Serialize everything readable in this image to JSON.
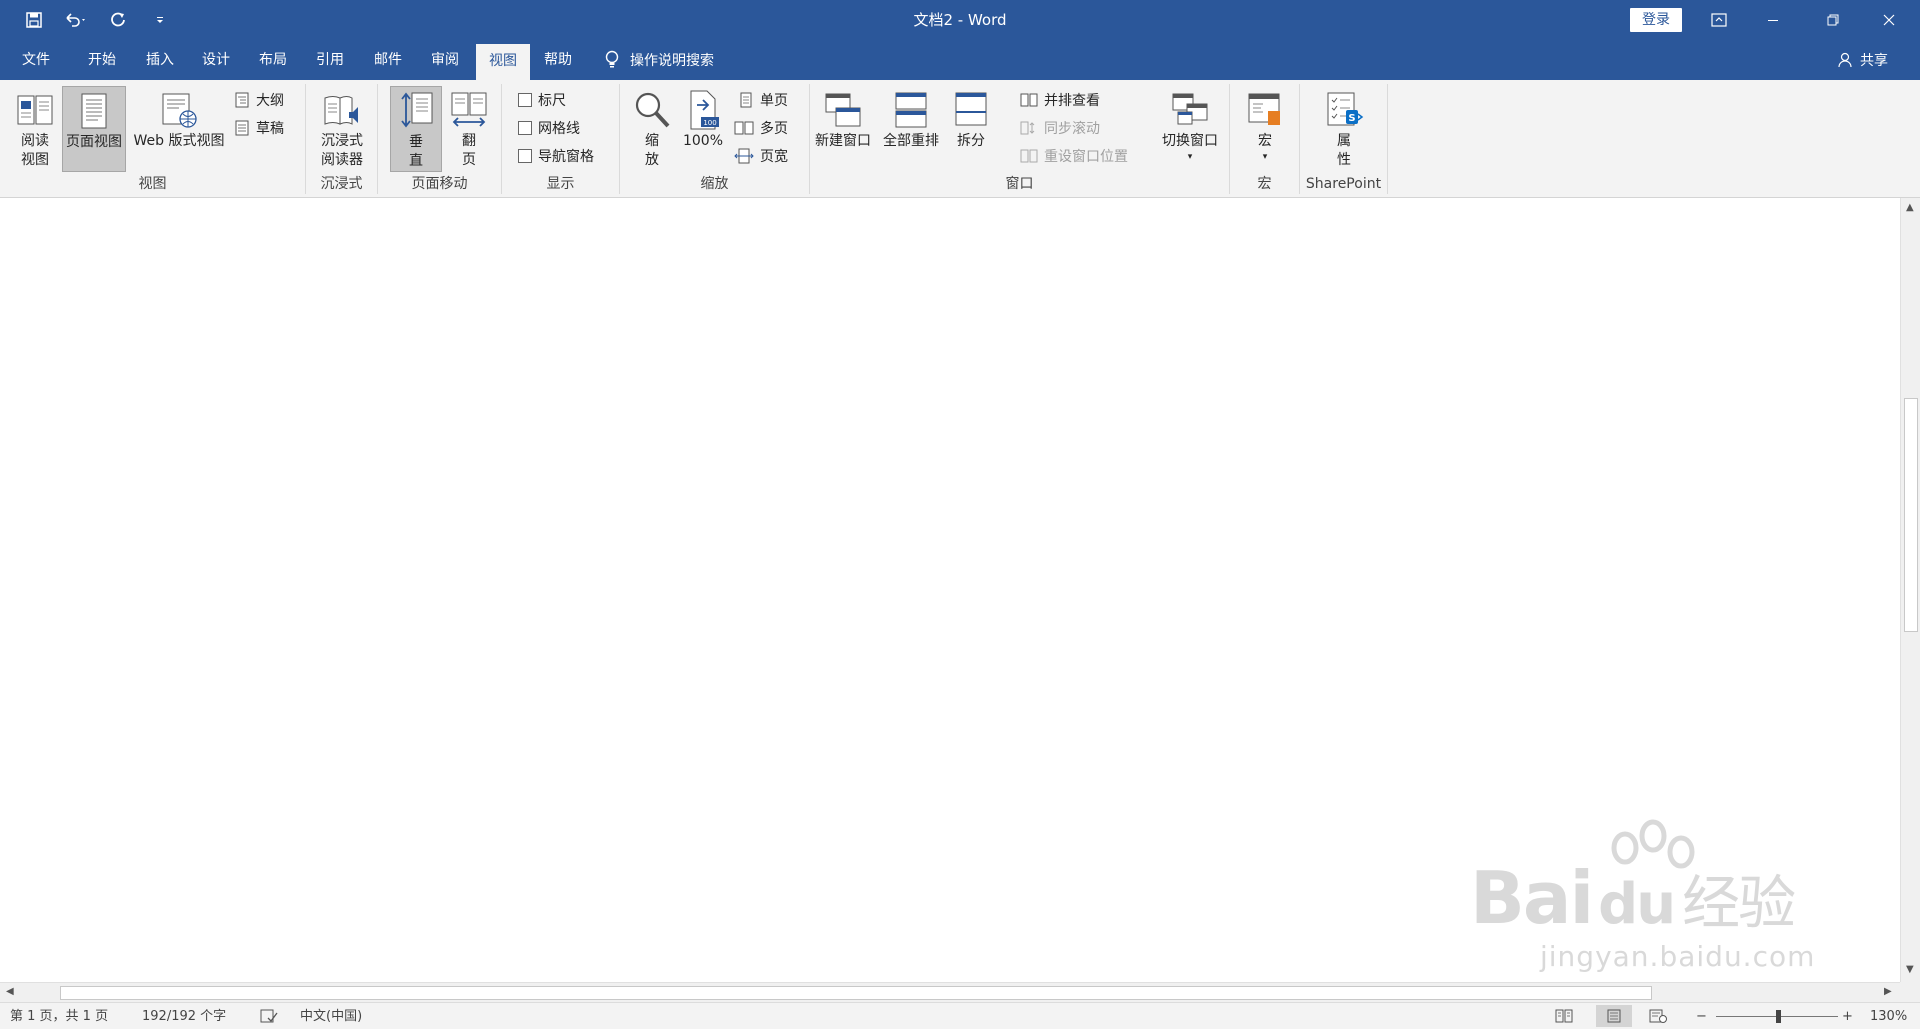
{
  "titlebar": {
    "title": "文档2  -  Word",
    "login": "登录",
    "bg": "#2b579a"
  },
  "tabs": [
    "文件",
    "开始",
    "插入",
    "设计",
    "布局",
    "引用",
    "邮件",
    "审阅",
    "视图",
    "帮助"
  ],
  "active_tab": "视图",
  "tellme": "操作说明搜索",
  "share": "共享",
  "ribbon": {
    "views": {
      "label": "视图",
      "read": "阅读\n视图",
      "print": "页面视图",
      "web": "Web 版式视图",
      "outline": "大纲",
      "draft": "草稿"
    },
    "immersive": {
      "label": "沉浸式",
      "reader": "沉浸式\n阅读器"
    },
    "pagemove": {
      "label": "页面移动",
      "vertical": "垂\n直",
      "side": "翻\n页"
    },
    "show": {
      "label": "显示",
      "ruler": "标尺",
      "gridlines": "网格线",
      "nav": "导航窗格"
    },
    "zoom": {
      "label": "缩放",
      "zoom": "缩\n放",
      "hundred": "100%",
      "one": "单页",
      "multi": "多页",
      "width": "页宽"
    },
    "window": {
      "label": "窗口",
      "new": "新建窗口",
      "arrange": "全部重排",
      "split": "拆分",
      "sidebyside": "并排查看",
      "syncscroll": "同步滚动",
      "reset": "重设窗口位置",
      "switch": "切换窗口"
    },
    "macros": {
      "label": "宏",
      "macro": "宏"
    },
    "sharepoint": {
      "label": "SharePoint",
      "props": "属\n性"
    }
  },
  "status": {
    "page": "第 1 页，共 1 页",
    "words": "192/192 个字",
    "lang": "中文(中国)",
    "zoom": "130%",
    "zoom_minus": "−",
    "zoom_plus": "+"
  },
  "watermark": {
    "brand": "Bai",
    "brand2": "du",
    "brand3": "经验",
    "url": "jingyan.baidu.com"
  }
}
